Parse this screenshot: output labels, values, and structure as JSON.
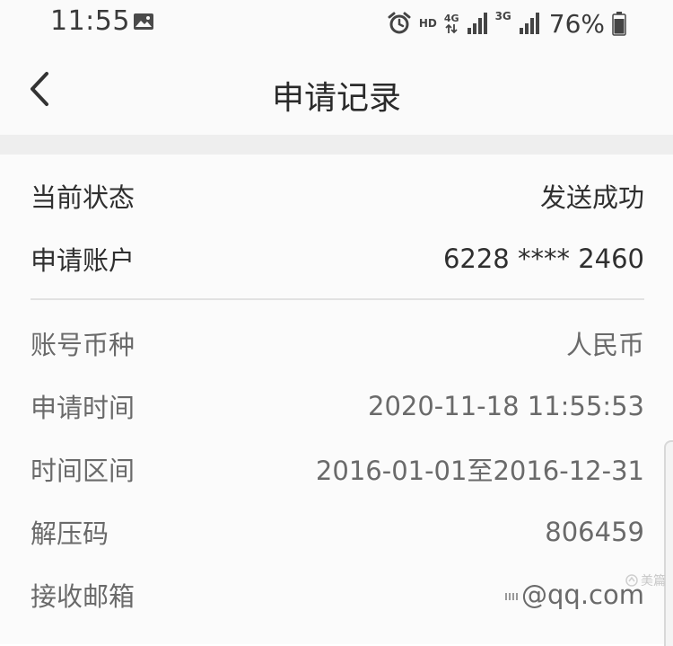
{
  "status_bar": {
    "time": "11:55",
    "hd": "HD",
    "net_4g": "4G",
    "net_3g": "3G",
    "battery": "76%",
    "icons": [
      "gallery-icon",
      "alarm-icon",
      "data-arrows-icon",
      "signal-icon",
      "signal-icon",
      "battery-icon"
    ]
  },
  "nav": {
    "back_icon": "chevron-left-icon",
    "title": "申请记录"
  },
  "record": {
    "current_status": {
      "label": "当前状态",
      "value": "发送成功"
    },
    "account": {
      "label": "申请账户",
      "value": "6228 **** 2460"
    },
    "currency": {
      "label": "账号币种",
      "value": "人民币"
    },
    "apply_time": {
      "label": "申请时间",
      "value": "2020-11-18 11:55:53"
    },
    "time_range": {
      "label": "时间区间",
      "value": "2016-01-01至2016-12-31"
    },
    "unzip_code": {
      "label": "解压码",
      "value": "806459"
    },
    "email": {
      "label": "接收邮箱",
      "value": "@qq.com"
    }
  },
  "watermark": {
    "text": "美篇"
  }
}
